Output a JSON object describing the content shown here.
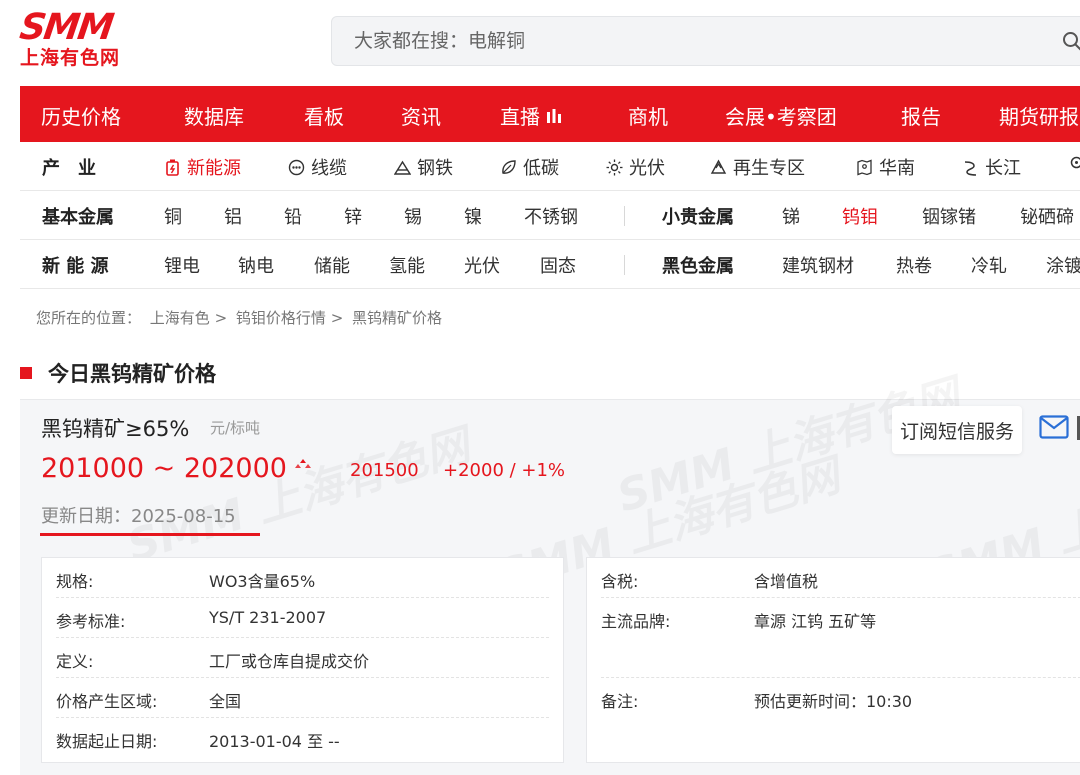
{
  "header": {
    "logo_text": "SMM",
    "logo_cn": "上海有色网",
    "search_placeholder": "大家都在搜：电解铜"
  },
  "main_nav": [
    {
      "label": "历史价格"
    },
    {
      "label": "数据库"
    },
    {
      "label": "看板"
    },
    {
      "label": "资讯"
    },
    {
      "label": "直播"
    },
    {
      "label": "商机"
    },
    {
      "label": "会展•考察团"
    },
    {
      "label": "报告"
    },
    {
      "label": "期货研报"
    }
  ],
  "industry_row": {
    "head": "产　业",
    "items": [
      "新能源",
      "线缆",
      "钢铁",
      "低碳",
      "光伏",
      "再生专区",
      "华南",
      "长江"
    ]
  },
  "base_metal_row": {
    "head": "基本金属",
    "items": [
      "铜",
      "铝",
      "铅",
      "锌",
      "锡",
      "镍",
      "不锈钢"
    ],
    "head2": "小贵金属",
    "items2": [
      "锑",
      "钨钼",
      "铟镓锗",
      "铋硒碲"
    ]
  },
  "new_energy_row": {
    "head": "新 能 源",
    "items": [
      "锂电",
      "钠电",
      "储能",
      "氢能",
      "光伏",
      "固态"
    ],
    "head2": "黑色金属",
    "items2": [
      "建筑钢材",
      "热卷",
      "冷轧",
      "涂镀"
    ]
  },
  "breadcrumb": [
    "您所在的位置：",
    "上海有色 >",
    "钨钼价格行情 >",
    "黑钨精矿价格"
  ],
  "section_title": "今日黑钨精矿价格",
  "product": {
    "name": "黑钨精矿≥65%",
    "unit": "元/标吨",
    "price_range": "201000 ~ 202000",
    "average": "201500",
    "change": "+2000  /  +1%",
    "update_date": "更新日期：2025-08-15",
    "sms_button": "订阅短信服务"
  },
  "info_left": [
    {
      "k": "规格:",
      "v": "WO3含量65%"
    },
    {
      "k": "参考标准:",
      "v": "YS/T 231-2007"
    },
    {
      "k": "定义:",
      "v": "工厂或仓库自提成交价"
    },
    {
      "k": "价格产生区域:",
      "v": "全国"
    },
    {
      "k": "数据起止日期:",
      "v": "2013-01-04 至 --"
    }
  ],
  "info_right": [
    {
      "k": "含税:",
      "v": "含增值税"
    },
    {
      "k": "主流品牌:",
      "v": "章源 江钨 五矿等"
    },
    {
      "k": "",
      "v": ""
    },
    {
      "k": "备注:",
      "v": "预估更新时间：10:30"
    },
    {
      "k": "",
      "v": ""
    }
  ],
  "watermark_text": "SMM 上海有色网",
  "colors": {
    "brand_red": "#e5161e",
    "bg_grey": "#f5f6f8"
  }
}
